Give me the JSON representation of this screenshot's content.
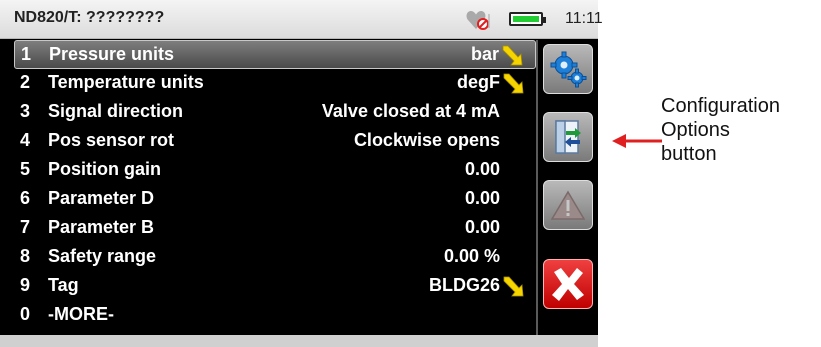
{
  "status": {
    "device_title": "ND820/T: ????????",
    "time": "11:11"
  },
  "menu": {
    "items": [
      {
        "num": "1",
        "label": "Pressure units",
        "value": "bar",
        "selected": true,
        "editable": true
      },
      {
        "num": "2",
        "label": "Temperature units",
        "value": "degF",
        "editable": true
      },
      {
        "num": "3",
        "label": "Signal direction",
        "value": "Valve closed at 4 mA"
      },
      {
        "num": "4",
        "label": "Pos sensor rot",
        "value": "Clockwise opens"
      },
      {
        "num": "5",
        "label": "Position gain",
        "value": "0.00"
      },
      {
        "num": "6",
        "label": "Parameter D",
        "value": "0.00"
      },
      {
        "num": "7",
        "label": "Parameter B",
        "value": "0.00"
      },
      {
        "num": "8",
        "label": "Safety range",
        "value": "0.00 %"
      },
      {
        "num": "9",
        "label": "Tag",
        "value": "BLDG26",
        "editable": true
      },
      {
        "num": "0",
        "label": "-MORE-",
        "value": ""
      }
    ]
  },
  "side_buttons": [
    {
      "icon": "gears-icon",
      "color": "gray"
    },
    {
      "icon": "configuration-options-icon",
      "color": "gray"
    },
    {
      "icon": "warning-icon",
      "color": "gray"
    },
    {
      "icon": "close-x-icon",
      "color": "red"
    }
  ],
  "annotation": {
    "line1": "Configuration",
    "line2": "Options",
    "line3": "button",
    "arrow_color": "#e02020"
  },
  "colors": {
    "screen_bg": "#000000",
    "edit_arrow": "#f5d400",
    "close_button": "#d81818",
    "battery": "#22cc33"
  }
}
